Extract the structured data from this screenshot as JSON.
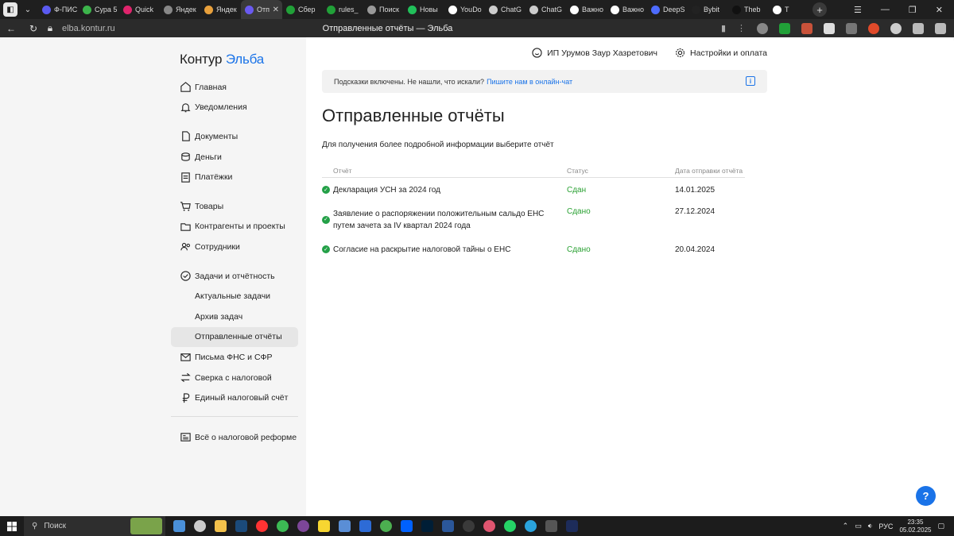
{
  "browser": {
    "tabs": [
      {
        "label": "Ф-ПИС",
        "color": "#5a5af0"
      },
      {
        "label": "Сура 5",
        "color": "#3cb44b"
      },
      {
        "label": "Quick",
        "color": "#e0246c"
      },
      {
        "label": "Яндек",
        "color": "#888888"
      },
      {
        "label": "Яндек",
        "color": "#e8a03c"
      },
      {
        "label": "Отп",
        "color": "#6a5af0",
        "active": true
      },
      {
        "label": "Сбер",
        "color": "#21a038"
      },
      {
        "label": "rules_",
        "color": "#21a038"
      },
      {
        "label": "Поиск",
        "color": "#999999"
      },
      {
        "label": "Новы",
        "color": "#21c05a"
      },
      {
        "label": "YouDo",
        "color": "#ffffff"
      },
      {
        "label": "ChatG",
        "color": "#cccccc"
      },
      {
        "label": "ChatG",
        "color": "#cccccc"
      },
      {
        "label": "Важно",
        "color": "#ffffff"
      },
      {
        "label": "Важно",
        "color": "#ffffff"
      },
      {
        "label": "DeepS",
        "color": "#4d6bfe"
      },
      {
        "label": "Bybit",
        "color": "#222222"
      },
      {
        "label": "Theb",
        "color": "#111111"
      },
      {
        "label": "T",
        "color": "#ffffff"
      }
    ],
    "url": "elba.kontur.ru",
    "page_title": "Отправленные отчёты — Эльба"
  },
  "sidebar": {
    "logo_part1": "Контур",
    "logo_part2": "Эльба",
    "group1": [
      {
        "label": "Главная",
        "icon": "home-icon"
      },
      {
        "label": "Уведомления",
        "icon": "bell-icon"
      }
    ],
    "group2": [
      {
        "label": "Документы",
        "icon": "document-icon"
      },
      {
        "label": "Деньги",
        "icon": "money-icon"
      },
      {
        "label": "Платёжки",
        "icon": "payment-icon"
      }
    ],
    "group3": [
      {
        "label": "Товары",
        "icon": "cart-icon"
      },
      {
        "label": "Контрагенты и проекты",
        "icon": "folder-icon"
      },
      {
        "label": "Сотрудники",
        "icon": "people-icon"
      }
    ],
    "group4": [
      {
        "label": "Задачи и отчётность",
        "icon": "check-circle-icon"
      },
      {
        "label": "Актуальные задачи"
      },
      {
        "label": "Архив задач"
      },
      {
        "label": "Отправленные отчёты",
        "active": true
      },
      {
        "label": "Письма ФНС и СФР",
        "icon": "mail-icon"
      },
      {
        "label": "Сверка с налоговой",
        "icon": "arrows-icon"
      },
      {
        "label": "Единый налоговый счёт",
        "icon": "ruble-icon"
      }
    ],
    "bottom": {
      "label": "Всё о налоговой реформе",
      "icon": "news-icon"
    }
  },
  "header": {
    "user": "ИП Урумов Заур Хазретович",
    "settings": "Настройки и оплата"
  },
  "hint": {
    "text": "Подсказки включены. Не нашли, что искали?",
    "link": "Пишите нам в онлайн-чат"
  },
  "main": {
    "title": "Отправленные отчёты",
    "description": "Для получения более подробной информации выберите отчёт"
  },
  "table": {
    "headers": {
      "report": "Отчёт",
      "status": "Статус",
      "date": "Дата отправки отчёта"
    },
    "rows": [
      {
        "report": "Декларация УСН за 2024 год",
        "status": "Сдан",
        "date": "14.01.2025"
      },
      {
        "report": "Заявление о распоряжении положительным сальдо ЕНС путем зачета за IV квартал 2024 года",
        "status": "Сдано",
        "date": "27.12.2024"
      },
      {
        "report": "Согласие на раскрытие налоговой тайны о ЕНС",
        "status": "Сдано",
        "date": "20.04.2024"
      }
    ]
  },
  "help_label": "?",
  "taskbar": {
    "search": "Поиск",
    "lang": "РУС",
    "time": "23:35",
    "date": "05.02.2025"
  },
  "colors": {
    "accent": "#1a73e8",
    "success": "#2aa133",
    "check": "#23a047"
  }
}
